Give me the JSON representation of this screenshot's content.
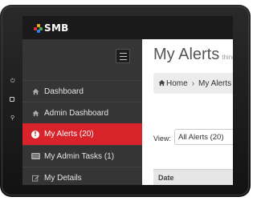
{
  "app": {
    "logo_text": "SMB",
    "brand_colors": {
      "topbar": "#1a1a1a",
      "sidebar": "#353535",
      "active": "#d8232a"
    }
  },
  "sidebar": {
    "items": [
      {
        "label": "Dashboard",
        "icon": "home-icon",
        "active": false
      },
      {
        "label": "Admin Dashboard",
        "icon": "home-icon",
        "active": false
      },
      {
        "label": "My Alerts (20)",
        "icon": "alert-icon",
        "active": true
      },
      {
        "label": "My Admin Tasks (1)",
        "icon": "tasks-icon",
        "active": false
      },
      {
        "label": "My Details",
        "icon": "edit-icon",
        "active": false
      }
    ]
  },
  "main": {
    "title": "My Alerts",
    "subtitle": "thing",
    "breadcrumb": [
      "Home",
      "My Alerts"
    ],
    "view_label": "View:",
    "view_selected": "All Alerts (20)",
    "table": {
      "columns": [
        "Date"
      ]
    }
  }
}
